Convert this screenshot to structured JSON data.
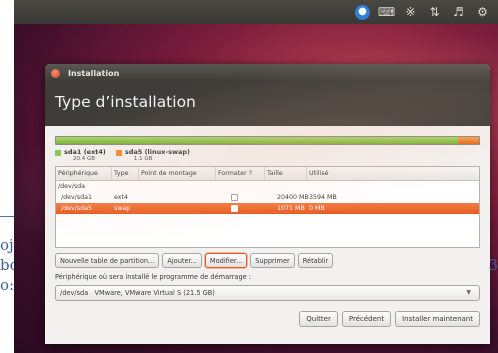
{
  "panel": {
    "icons": [
      "accessibility-icon",
      "keyboard-icon",
      "bluetooth-icon",
      "network-icon",
      "volume-icon",
      "gear-icon"
    ]
  },
  "background_doc": {
    "lines": [
      "oj",
      "bo",
      "o:"
    ],
    "right": "3"
  },
  "window": {
    "title": "Installation",
    "header": "Type d’installation"
  },
  "partition_bar": {
    "segments": [
      {
        "name": "sda1 (ext4)",
        "size": "20.4 GB",
        "color": "#8dc655",
        "fraction": 0.95
      },
      {
        "name": "sda5 (linux-swap)",
        "size": "1.1 GB",
        "color": "#f08a35",
        "fraction": 0.05
      }
    ]
  },
  "table": {
    "headers": [
      "Périphérique",
      "Type",
      "Point de montage",
      "Formater ?",
      "Taille",
      "Utilisé"
    ],
    "rows": [
      {
        "device": "/dev/sda",
        "type": "",
        "mount": "",
        "format": false,
        "size": "",
        "used": "",
        "has_checkbox": false,
        "selected": false
      },
      {
        "device": "/dev/sda1",
        "type": "ext4",
        "mount": "",
        "format": false,
        "size": "20400 MB",
        "used": "3594 MB",
        "has_checkbox": true,
        "selected": false
      },
      {
        "device": "/dev/sda5",
        "type": "swap",
        "mount": "",
        "format": false,
        "size": "1071 MB",
        "used": "0 MB",
        "has_checkbox": true,
        "selected": true
      }
    ]
  },
  "actions": {
    "new_table": "Nouvelle table de partition...",
    "add": "Ajouter...",
    "modify": "Modifier...",
    "delete": "Supprimer",
    "revert": "Rétablir"
  },
  "bootloader": {
    "label": "Périphérique où sera installé le programme de démarrage :",
    "selected": "/dev/sda   VMware, VMware Virtual S (21.5 GB)"
  },
  "footer": {
    "quit": "Quitter",
    "back": "Précédent",
    "install": "Installer maintenant"
  },
  "colors": {
    "accent": "#e95420",
    "selection": "#ec6a2c"
  }
}
